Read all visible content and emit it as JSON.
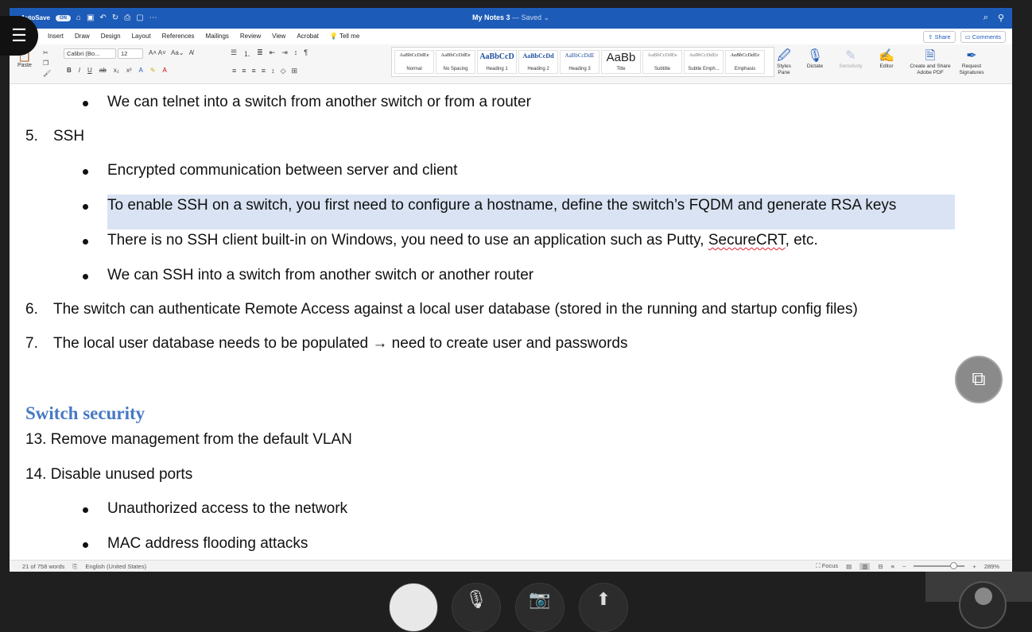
{
  "titlebar": {
    "autosave": "AutoSave",
    "toggle": "ON",
    "doc_title": "My Notes 3",
    "saved": "— Saved ⌄"
  },
  "menu": {
    "tabs": [
      "Insert",
      "Draw",
      "Design",
      "Layout",
      "References",
      "Mailings",
      "Review",
      "View",
      "Acrobat",
      "Tell me"
    ],
    "share": "Share",
    "comments": "Comments"
  },
  "ribbon": {
    "paste": "Paste",
    "font": "Calibri (Bo...",
    "size": "12",
    "styles": [
      {
        "preview": "AaBbCcDdEe",
        "name": "Normal"
      },
      {
        "preview": "AaBbCcDdEe",
        "name": "No Spacing"
      },
      {
        "preview": "AaBbCcD",
        "name": "Heading 1"
      },
      {
        "preview": "AaBbCcDd",
        "name": "Heading 2"
      },
      {
        "preview": "AaBbCcDdE",
        "name": "Heading 3"
      },
      {
        "preview": "AaBb",
        "name": "Title"
      },
      {
        "preview": "AaBbCcDdEe",
        "name": "Subtitle"
      },
      {
        "preview": "AaBbCcDdEe",
        "name": "Subtle Emph..."
      },
      {
        "preview": "AaBbCcDdEe",
        "name": "Emphasis"
      }
    ],
    "styles_pane": "Styles Pane",
    "dictate": "Dictate",
    "sensitivity": "Sensitivity",
    "editor": "Editor",
    "create_share": "Create and Share Adobe PDF",
    "request_sig": "Request Signatures"
  },
  "document": {
    "b_telnet": "We can telnet into a switch from another switch or from a router",
    "n5": "5.",
    "ssh": "SSH",
    "b_encrypted": "Encrypted communication between server and client",
    "b_enable": "To enable SSH on a switch, you first need to configure a hostname, define the switch’s FQDM and generate RSA keys",
    "b_noclient_a": "There is no SSH client built-in on Windows, you need to use an application such as Putty, ",
    "b_noclient_b": "SecureCRT",
    "b_noclient_c": ", etc.",
    "b_sshinto": "We can SSH into a switch from another switch or another router",
    "n6": "6.",
    "t6": "The switch can authenticate Remote Access against a local user database (stored in the running and startup config files)",
    "n7": "7.",
    "t7": "The local user database needs to be populated → need to create user and passwords",
    "heading": "Switch security",
    "t13": "13. Remove management from the default VLAN",
    "t14": "14. Disable unused ports",
    "b_unauth": "Unauthorized access to the network",
    "b_mac": "MAC address flooding attacks"
  },
  "statusbar": {
    "words": "21 of 758 words",
    "language": "English (United States)",
    "focus": "Focus",
    "zoom": "289%"
  }
}
